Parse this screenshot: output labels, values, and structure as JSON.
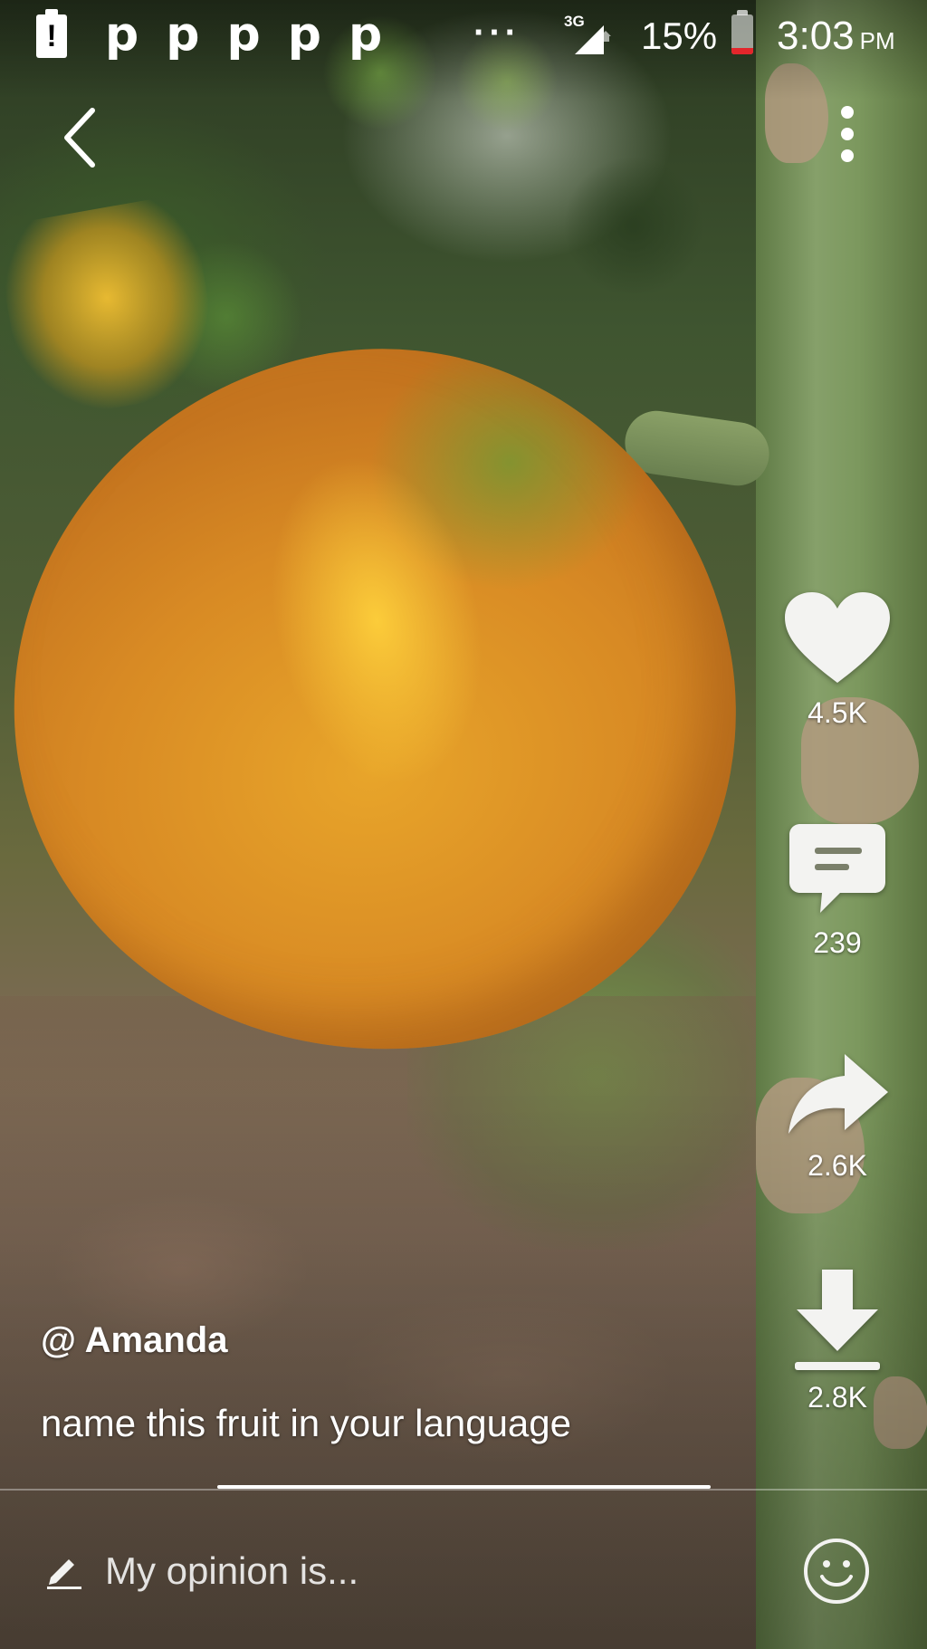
{
  "status_bar": {
    "battery_alert_glyph": "!",
    "notification_glyphs": [
      "p",
      "p",
      "p",
      "p",
      "p"
    ],
    "more_notifications": "···",
    "network_type": "3G",
    "battery_percent": "15%",
    "battery_level": 0.15,
    "time": "3:03",
    "ampm": "PM"
  },
  "icons": {
    "back": "back-arrow-icon",
    "more": "more-vertical-icon",
    "like": "heart-icon",
    "comment": "comment-icon",
    "share": "share-arrow-icon",
    "download": "download-icon",
    "edit": "pencil-icon",
    "emoji": "smiley-icon"
  },
  "actions": {
    "likes": "4.5K",
    "comments": "239",
    "shares": "2.6K",
    "downloads": "2.8K"
  },
  "post": {
    "author": "@ Amanda",
    "caption": "name this fruit in your language"
  },
  "comment_input": {
    "placeholder": "My opinion is...",
    "value": ""
  },
  "colors": {
    "battery_low": "#e3262b",
    "overlay_text": "#ffffff"
  }
}
